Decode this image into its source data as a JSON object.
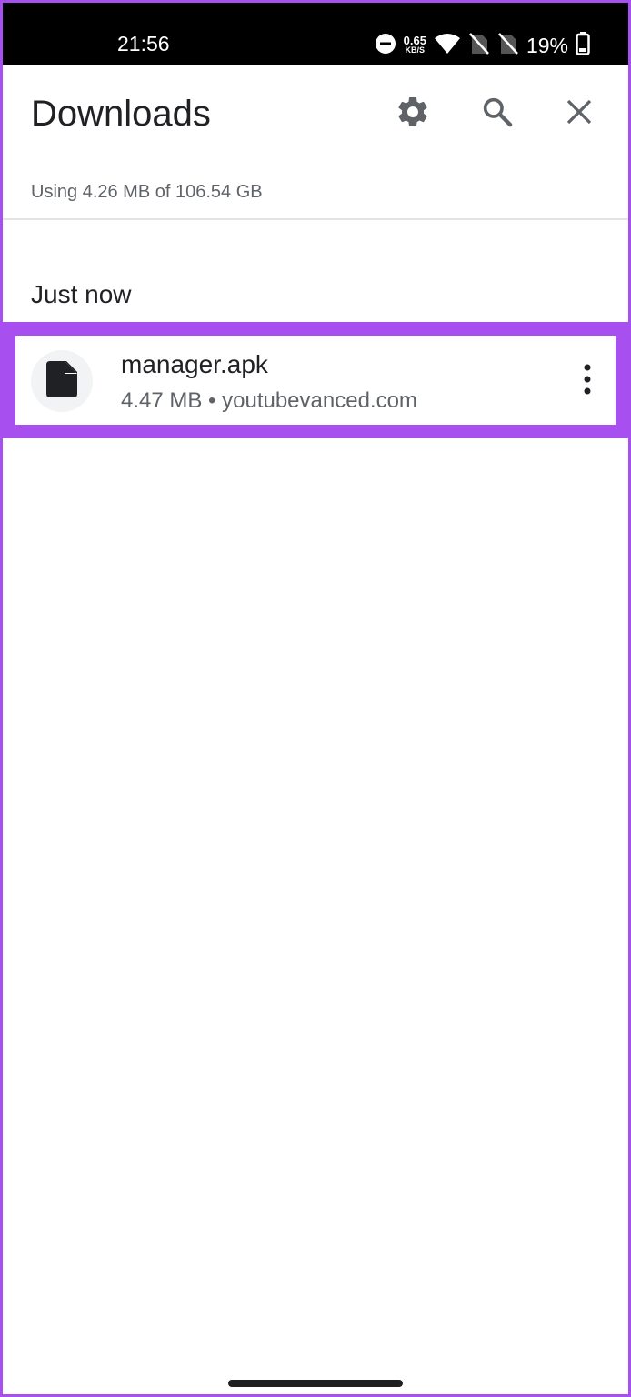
{
  "status_bar": {
    "time": "21:56",
    "net_speed_value": "0.65",
    "net_speed_unit": "KB/S",
    "battery": "19%",
    "icons": [
      "do-not-disturb-icon",
      "wifi-icon",
      "no-sim-icon",
      "no-sim-icon",
      "battery-icon"
    ]
  },
  "header": {
    "title": "Downloads",
    "icons": [
      "gear-icon",
      "search-icon",
      "close-icon"
    ]
  },
  "storage": {
    "text": "Using 4.26 MB of 106.54 GB"
  },
  "sections": [
    {
      "label": "Just now",
      "items": [
        {
          "name": "manager.apk",
          "meta": "4.47 MB • youtubevanced.com",
          "icon": "file-icon"
        }
      ]
    }
  ],
  "colors": {
    "highlight": "#a84ff0",
    "text_primary": "#202124",
    "text_secondary": "#5f6368"
  }
}
